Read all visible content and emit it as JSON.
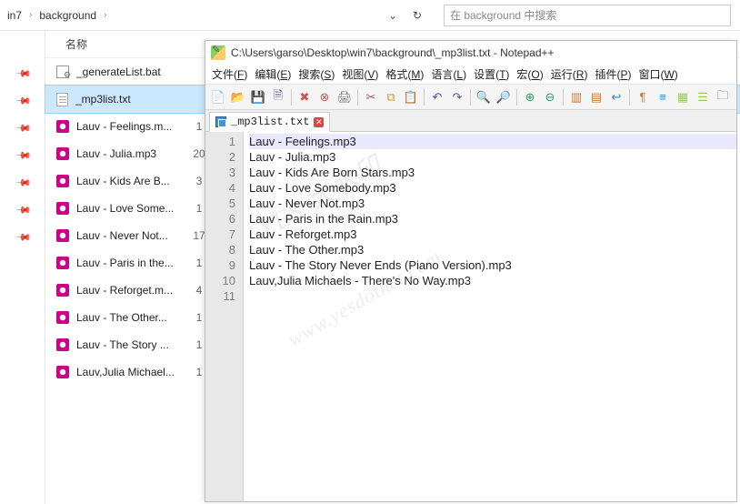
{
  "explorer": {
    "breadcrumb": [
      "in7",
      "background"
    ],
    "search_placeholder": "在 background 中搜索",
    "columns": {
      "name": "名称",
      "count": "#"
    },
    "files": [
      {
        "name": "_generateList.bat",
        "count": "",
        "type": "bat",
        "selected": false
      },
      {
        "name": "_mp3list.txt",
        "count": "",
        "type": "txt",
        "selected": true
      },
      {
        "name": "Lauv - Feelings.m...",
        "count": "1",
        "type": "mp3",
        "selected": false
      },
      {
        "name": "Lauv - Julia.mp3",
        "count": "20",
        "type": "mp3",
        "selected": false
      },
      {
        "name": "Lauv - Kids Are B...",
        "count": "3",
        "type": "mp3",
        "selected": false
      },
      {
        "name": "Lauv - Love Some...",
        "count": "1",
        "type": "mp3",
        "selected": false
      },
      {
        "name": "Lauv - Never Not...",
        "count": "17",
        "type": "mp3",
        "selected": false
      },
      {
        "name": "Lauv - Paris in the...",
        "count": "1",
        "type": "mp3",
        "selected": false
      },
      {
        "name": "Lauv - Reforget.m...",
        "count": "4",
        "type": "mp3",
        "selected": false
      },
      {
        "name": "Lauv - The Other...",
        "count": "1",
        "type": "mp3",
        "selected": false
      },
      {
        "name": "Lauv - The Story ...",
        "count": "1",
        "type": "mp3",
        "selected": false
      },
      {
        "name": "Lauv,Julia Michael...",
        "count": "1",
        "type": "mp3",
        "selected": false
      }
    ],
    "pins": 7
  },
  "notepad": {
    "title": "C:\\Users\\garso\\Desktop\\win7\\background\\_mp3list.txt - Notepad++",
    "menus": [
      "文件(F)",
      "编辑(E)",
      "搜索(S)",
      "视图(V)",
      "格式(M)",
      "语言(L)",
      "设置(T)",
      "宏(O)",
      "运行(R)",
      "插件(P)",
      "窗口(W)"
    ],
    "tab": "_mp3list.txt",
    "lines": [
      "Lauv - Feelings.mp3",
      "Lauv - Julia.mp3",
      "Lauv - Kids Are Born Stars.mp3",
      "Lauv - Love Somebody.mp3",
      "Lauv - Never Not.mp3",
      "Lauv - Paris in the Rain.mp3",
      "Lauv - Reforget.mp3",
      "Lauv - The Other.mp3",
      "Lauv - The Story Never Ends (Piano Version).mp3",
      "Lauv,Julia Michaels - There's No Way.mp3",
      ""
    ],
    "toolbar_icons": [
      {
        "n": "new-file-icon",
        "g": "📄",
        "c": "#6a6"
      },
      {
        "n": "open-file-icon",
        "g": "📂",
        "c": "#c93"
      },
      {
        "n": "save-icon",
        "g": "💾",
        "c": "#557"
      },
      {
        "n": "save-all-icon",
        "g": "🗎",
        "c": "#557"
      },
      {
        "sep": true
      },
      {
        "n": "close-icon",
        "g": "✖",
        "c": "#c55"
      },
      {
        "n": "close-all-icon",
        "g": "⊗",
        "c": "#c55"
      },
      {
        "n": "print-icon",
        "g": "🖨",
        "c": "#777"
      },
      {
        "sep": true
      },
      {
        "n": "cut-icon",
        "g": "✂",
        "c": "#a55"
      },
      {
        "n": "copy-icon",
        "g": "⧉",
        "c": "#c93"
      },
      {
        "n": "paste-icon",
        "g": "📋",
        "c": "#c93"
      },
      {
        "sep": true
      },
      {
        "n": "undo-icon",
        "g": "↶",
        "c": "#55a"
      },
      {
        "n": "redo-icon",
        "g": "↷",
        "c": "#55a"
      },
      {
        "sep": true
      },
      {
        "n": "find-icon",
        "g": "🔍",
        "c": "#666"
      },
      {
        "n": "replace-icon",
        "g": "🔎",
        "c": "#666"
      },
      {
        "sep": true
      },
      {
        "n": "zoom-in-icon",
        "g": "⊕",
        "c": "#396"
      },
      {
        "n": "zoom-out-icon",
        "g": "⊖",
        "c": "#396"
      },
      {
        "sep": true
      },
      {
        "n": "sync-v-icon",
        "g": "▥",
        "c": "#c73"
      },
      {
        "n": "sync-h-icon",
        "g": "▤",
        "c": "#c73"
      },
      {
        "n": "wrap-icon",
        "g": "↩",
        "c": "#38c"
      },
      {
        "sep": true
      },
      {
        "n": "show-all-icon",
        "g": "¶",
        "c": "#c73"
      },
      {
        "n": "indent-guide-icon",
        "g": "≡",
        "c": "#38c"
      },
      {
        "n": "doc-map-icon",
        "g": "▦",
        "c": "#9c6"
      },
      {
        "n": "func-list-icon",
        "g": "☰",
        "c": "#9c6"
      },
      {
        "n": "folder-tree-icon",
        "g": "🗀",
        "c": "#666"
      }
    ]
  },
  "watermark": {
    "line1": "YES 大水印",
    "line2": "www.yesdotnet.com"
  }
}
